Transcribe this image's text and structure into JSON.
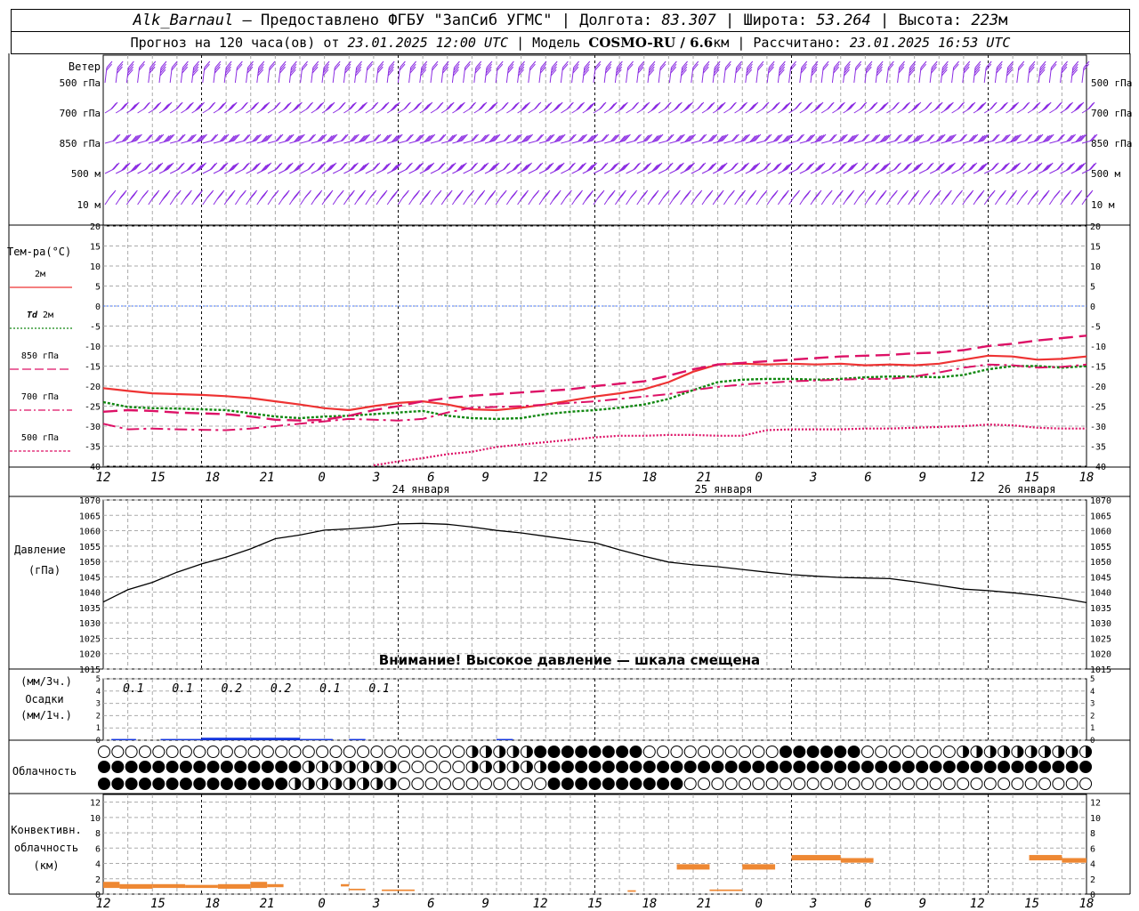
{
  "header": {
    "station": "Alk_Barnaul",
    "provider": " — Предоставлено ФГБУ \"ЗапСиб УГМС\" | Долгота: ",
    "lon": "83.307",
    "lat_label": " | Широта: ",
    "lat": "53.264",
    "alt_label": " | Высота: ",
    "alt": "223",
    "alt_unit": "м",
    "forecast_prefix": "Прогноз на 120 часа(ов) от ",
    "forecast_date": "23.01.2025 12:00 UTC",
    "model_label": " | Модель ",
    "model": "COSMO-RU / 6.6",
    "model_unit": "км",
    "calc_label": " | Рассчитано: ",
    "calc_date": "23.01.2025 16:53 UTC"
  },
  "wind_panel": {
    "title": "Ветер",
    "levels": [
      "500 гПа",
      "700 гПа",
      "850 гПа",
      "500 м",
      "10 м"
    ],
    "color": "#8a2be2"
  },
  "x_axis": {
    "hour_ticks": [
      "12",
      "15",
      "18",
      "21",
      "0",
      "3",
      "6",
      "9",
      "12",
      "15",
      "18",
      "21",
      "0",
      "3",
      "6",
      "9",
      "12",
      "15",
      "18"
    ],
    "day_labels": [
      "24 января",
      "25 января",
      "26 января"
    ]
  },
  "temp_panel": {
    "title": "Тем-ра(°С)",
    "legend": [
      "2м",
      "Td 2м",
      "850 гПа",
      "700 гПа",
      "500 гПа"
    ],
    "y_ticks": [
      "20",
      "15",
      "10",
      "5",
      "0",
      "-5",
      "-10",
      "-15",
      "-20",
      "-25",
      "-30",
      "-35",
      "-40"
    ]
  },
  "pressure_panel": {
    "title": "Давление",
    "unit": "(гПа)",
    "y_ticks": [
      "1070",
      "1065",
      "1060",
      "1055",
      "1050",
      "1045",
      "1040",
      "1035",
      "1030",
      "1025",
      "1020",
      "1015"
    ],
    "warning": "Внимание! Высокое давление — шкала смещена"
  },
  "precip_panel": {
    "label_top": "(мм/3ч.)",
    "title": "Осадки",
    "label_bottom": "(мм/1ч.)",
    "y_ticks": [
      "5",
      "4",
      "3",
      "2",
      "1",
      "0"
    ],
    "amounts": [
      "0.1",
      "0.1",
      "0.2",
      "0.2",
      "0.1",
      "0.1"
    ]
  },
  "cloud_panel": {
    "title": "Облачность"
  },
  "conv_panel": {
    "title": [
      "Конвективн.",
      "облачность",
      "(км)"
    ],
    "y_ticks": [
      "12",
      "10",
      "8",
      "6",
      "4",
      "2",
      "0"
    ]
  },
  "chart_data": [
    {
      "type": "line",
      "title": "Тем-ра(°С)",
      "x": [
        0,
        3,
        6,
        9,
        12,
        15,
        18,
        21,
        24,
        27,
        30,
        33,
        36,
        39,
        42,
        45,
        48,
        51,
        54,
        57,
        60,
        63,
        66,
        69,
        72,
        75,
        78,
        81,
        84,
        87,
        90,
        93,
        96,
        99,
        102,
        105,
        108,
        111,
        114,
        117,
        120
      ],
      "ylim": [
        -40,
        20
      ],
      "series": [
        {
          "name": "2м",
          "color": "#ee3333",
          "values": [
            -20.5,
            -21.2,
            -21.8,
            -22,
            -22.2,
            -22.5,
            -23,
            -23.8,
            -24.6,
            -25.5,
            -26,
            -25,
            -24.2,
            -23.8,
            -24.6,
            -25.8,
            -26,
            -25.4,
            -24.6,
            -23.6,
            -22.6,
            -21.8,
            -20.8,
            -19,
            -16.4,
            -14.6,
            -14.4,
            -14.6,
            -14.4,
            -14.6,
            -14.4,
            -14.8,
            -14.6,
            -14.8,
            -14.4,
            -13.4,
            -12.4,
            -12.6,
            -13.4,
            -13.2,
            -12.6
          ]
        },
        {
          "name": "Td 2м",
          "color": "#118811",
          "values": [
            -24,
            -25.2,
            -25.5,
            -25.6,
            -25.8,
            -26,
            -26.8,
            -27.6,
            -28,
            -27.6,
            -27.4,
            -27,
            -26.6,
            -26.2,
            -27.4,
            -28,
            -28.2,
            -28,
            -27,
            -26.4,
            -26,
            -25.4,
            -24.6,
            -23.2,
            -21,
            -19,
            -18.4,
            -18.2,
            -18.2,
            -18.4,
            -18.2,
            -17.8,
            -17.6,
            -17.6,
            -17.8,
            -17.2,
            -15.8,
            -15,
            -15,
            -15.4,
            -15
          ]
        },
        {
          "name": "850 гПа",
          "color": "#dd1166",
          "values": [
            -26.4,
            -26,
            -26.2,
            -26.6,
            -26.8,
            -27,
            -27.6,
            -28.4,
            -28.6,
            -28.4,
            -27.4,
            -26,
            -25,
            -23.8,
            -23,
            -22.4,
            -22,
            -21.6,
            -21.2,
            -20.8,
            -20,
            -19.4,
            -18.8,
            -17.4,
            -15.8,
            -14.6,
            -14.2,
            -13.8,
            -13.4,
            -13,
            -12.6,
            -12.4,
            -12.2,
            -11.8,
            -11.6,
            -11,
            -10,
            -9.4,
            -8.6,
            -8,
            -7.4
          ]
        },
        {
          "name": "700 гПа",
          "color": "#dd1166",
          "values": [
            -29.4,
            -30.8,
            -30.6,
            -30.8,
            -30.9,
            -31,
            -30.6,
            -30,
            -29.4,
            -28.8,
            -28.2,
            -28.4,
            -28.6,
            -28.2,
            -26.6,
            -25.4,
            -25.2,
            -25,
            -24.6,
            -24.2,
            -23.8,
            -23.2,
            -22.6,
            -22,
            -21,
            -20.2,
            -19.6,
            -19.2,
            -18.8,
            -18.6,
            -18.4,
            -18.2,
            -18.2,
            -17.6,
            -16.6,
            -15.4,
            -14.6,
            -14.8,
            -15.4,
            -15.2,
            -14.6
          ]
        },
        {
          "name": "500 гПа",
          "color": "#dd1166",
          "values": [
            null,
            null,
            null,
            null,
            null,
            null,
            null,
            null,
            null,
            null,
            null,
            -39.8,
            -38.8,
            -38,
            -37,
            -36.4,
            -35.2,
            -34.6,
            -34,
            -33.4,
            -32.8,
            -32.4,
            -32.4,
            -32.2,
            -32.2,
            -32.4,
            -32.4,
            -31,
            -30.8,
            -30.8,
            -30.8,
            -30.6,
            -30.6,
            -30.4,
            -30.2,
            -30,
            -29.6,
            -29.8,
            -30.4,
            -30.6,
            -30.6
          ]
        }
      ]
    },
    {
      "type": "line",
      "title": "Давление",
      "x": [
        0,
        3,
        6,
        9,
        12,
        15,
        18,
        21,
        24,
        27,
        30,
        33,
        36,
        39,
        42,
        45,
        48,
        51,
        54,
        57,
        60,
        63,
        66,
        69,
        72,
        75,
        78,
        81,
        84,
        87,
        90,
        93,
        96,
        99,
        102,
        105,
        108,
        111,
        114,
        117,
        120
      ],
      "ylim": [
        1015,
        1070
      ],
      "series": [
        {
          "name": "Давление",
          "color": "#000000",
          "values": [
            1036.8,
            1040.8,
            1043.2,
            1046.5,
            1049.2,
            1051.4,
            1054.1,
            1057.4,
            1058.6,
            1060.2,
            1060.6,
            1061.2,
            1062.2,
            1062.4,
            1062.1,
            1061.2,
            1060.1,
            1059.3,
            1058.2,
            1057.1,
            1056.1,
            1053.8,
            1051.7,
            1049.8,
            1048.9,
            1048.3,
            1047.4,
            1046.5,
            1045.7,
            1045.2,
            1044.8,
            1044.6,
            1044.4,
            1043.4,
            1042.2,
            1041.0,
            1040.5,
            1039.8,
            1039.0,
            1038.0,
            1036.6
          ]
        }
      ]
    },
    {
      "type": "bar",
      "title": "Осадки",
      "ylim": [
        0,
        5
      ],
      "labels_x": [
        1.5,
        7.5,
        13.5,
        19.5,
        25.5,
        31.5
      ],
      "bars": [
        {
          "x0": 1,
          "x1": 4,
          "v": 0.1
        },
        {
          "x0": 7,
          "x1": 12,
          "v": 0.1
        },
        {
          "x0": 12,
          "x1": 18,
          "v": 0.2
        },
        {
          "x0": 18,
          "x1": 24,
          "v": 0.2
        },
        {
          "x0": 24,
          "x1": 28,
          "v": 0.1
        },
        {
          "x0": 30,
          "x1": 32,
          "v": 0.1
        },
        {
          "x0": 48,
          "x1": 50,
          "v": 0.1
        }
      ]
    },
    {
      "type": "bar",
      "title": "Конвективн. облачность (км)",
      "ylim": [
        0,
        13
      ],
      "bars": [
        {
          "x0": 0,
          "x1": 2,
          "lo": 0.8,
          "hi": 1.6
        },
        {
          "x0": 2,
          "x1": 6,
          "lo": 0.7,
          "hi": 1.3
        },
        {
          "x0": 6,
          "x1": 10,
          "lo": 0.8,
          "hi": 1.3
        },
        {
          "x0": 10,
          "x1": 14,
          "lo": 0.8,
          "hi": 1.2
        },
        {
          "x0": 14,
          "x1": 18,
          "lo": 0.7,
          "hi": 1.3
        },
        {
          "x0": 18,
          "x1": 20,
          "lo": 0.8,
          "hi": 1.6
        },
        {
          "x0": 20,
          "x1": 22,
          "lo": 0.9,
          "hi": 1.3
        },
        {
          "x0": 29,
          "x1": 30,
          "lo": 1.0,
          "hi": 1.3
        },
        {
          "x0": 30,
          "x1": 32,
          "lo": 0.5,
          "hi": 0.7
        },
        {
          "x0": 34,
          "x1": 38,
          "lo": 0.4,
          "hi": 0.6
        },
        {
          "x0": 64,
          "x1": 65,
          "lo": 0.3,
          "hi": 0.5
        },
        {
          "x0": 70,
          "x1": 74,
          "lo": 3.2,
          "hi": 3.9
        },
        {
          "x0": 74,
          "x1": 78,
          "lo": 0.4,
          "hi": 0.6
        },
        {
          "x0": 78,
          "x1": 82,
          "lo": 3.2,
          "hi": 3.9
        },
        {
          "x0": 84,
          "x1": 90,
          "lo": 4.4,
          "hi": 5.1
        },
        {
          "x0": 90,
          "x1": 94,
          "lo": 4.1,
          "hi": 4.7
        },
        {
          "x0": 113,
          "x1": 117,
          "lo": 4.4,
          "hi": 5.1
        },
        {
          "x0": 117,
          "x1": 120,
          "lo": 4.1,
          "hi": 4.7
        }
      ]
    }
  ]
}
